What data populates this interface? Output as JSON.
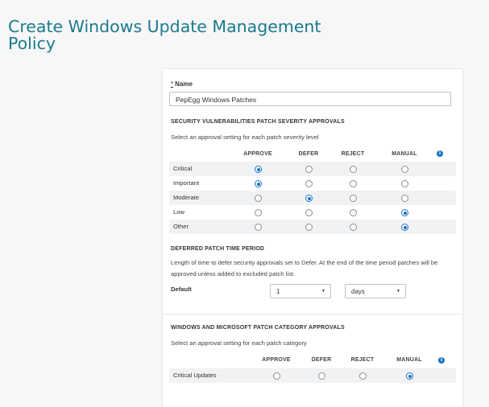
{
  "page": {
    "title": "Create Windows Update Management Policy"
  },
  "name_field": {
    "required_marker": "*",
    "label": "Name",
    "value": "PepEgg Windows Patches"
  },
  "severity": {
    "heading": "SECURITY VULNERABILITIES PATCH SEVERITY APPROVALS",
    "hint": "Select an approval setting for each patch severity level",
    "columns": [
      "APPROVE",
      "DEFER",
      "REJECT",
      "MANUAL"
    ],
    "rows": [
      {
        "label": "Critical",
        "selected": 0
      },
      {
        "label": "Important",
        "selected": 0
      },
      {
        "label": "Moderate",
        "selected": 1
      },
      {
        "label": "Low",
        "selected": 3
      },
      {
        "label": "Other",
        "selected": 3
      }
    ]
  },
  "deferred": {
    "heading": "DEFERRED PATCH TIME PERIOD",
    "description_line1": "Length of time to defer security approvals set to Defer. At the end of the time period patches will be",
    "description_line2": "approved unless added to excluded patch list.",
    "default_label": "Default",
    "amount_value": "1",
    "unit_value": "days"
  },
  "category": {
    "heading": "WINDOWS AND MICROSOFT PATCH CATEGORY APPROVALS",
    "hint": "Select an approval setting for each patch category",
    "columns": [
      "APPROVE",
      "DEFER",
      "REJECT",
      "MANUAL"
    ],
    "rows": [
      {
        "label": "Critical Updates",
        "selected": 3
      }
    ]
  },
  "info_icon_glyph": "i",
  "icons": {
    "info": "info-icon",
    "dropdown": "caret-down-icon"
  },
  "colors": {
    "title": "#1a7a8c",
    "accent": "#1a73c8"
  }
}
